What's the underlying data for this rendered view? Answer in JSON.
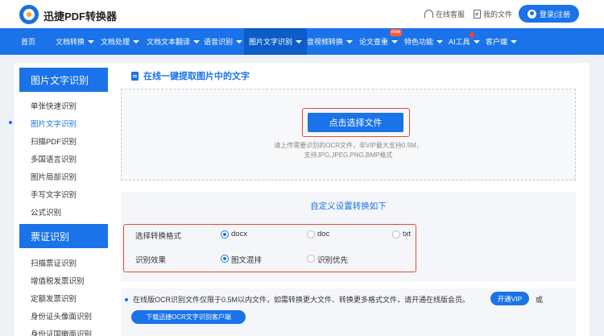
{
  "header": {
    "brand": "迅捷PDF转换器",
    "service_label": "在线客服",
    "my_files_label": "我的文件",
    "login_label": "登录|注册"
  },
  "nav": {
    "items": [
      {
        "label": "首页",
        "caret": false
      },
      {
        "label": "文档转换",
        "caret": true
      },
      {
        "label": "文档处理",
        "caret": true
      },
      {
        "label": "文档文本翻译",
        "caret": true
      },
      {
        "label": "语音识别",
        "caret": true
      },
      {
        "label": "图片文字识别",
        "caret": true,
        "active": true
      },
      {
        "label": "音视频转换",
        "caret": true
      },
      {
        "label": "论文查重",
        "caret": true
      },
      {
        "label": "特色功能",
        "caret": true
      },
      {
        "label": "AI工具",
        "caret": true
      },
      {
        "label": "客户端",
        "caret": true
      }
    ],
    "new_badge": "new"
  },
  "sidebar": {
    "section1_title": "图片文字识别",
    "section1_items": [
      "单张快速识别",
      "图片文字识别",
      "扫描PDF识别",
      "多国语言识别",
      "图片局部识别",
      "手写文字识别",
      "公式识别"
    ],
    "active_index": 1,
    "section2_title": "票证识别",
    "section2_items": [
      "扫描票证识别",
      "增值税发票识别",
      "定额发票识别",
      "身份证头像面识别",
      "身份证国徽面识别"
    ]
  },
  "main": {
    "title": "在线一键提取图片中的文字",
    "upload_button": "点击选择文件",
    "upload_hint_1": "请上传需要识别的OCR文件，非VIP最大支持0.5M，",
    "upload_hint_2": "支持JPG,JPEG,PNG,BMP格式",
    "settings_title": "自定义设置转换如下",
    "format_label": "选择转换格式",
    "format_options": [
      "docx",
      "doc",
      "txt"
    ],
    "format_selected": "docx",
    "effect_label": "识别效果",
    "effect_options": [
      "图文混排",
      "识别优先"
    ],
    "effect_selected": "图文混排",
    "notice_text": "在线版OCR识别文件仅限于0.5M以内文件，如需转换更大文件、转换更多格式文件，请开通在线版会员。",
    "vip_button": "开通VIP",
    "or_text": "或",
    "download_button": "下载迅捷OCR文字识别客户端"
  },
  "colors": {
    "primary": "#1a73e8",
    "highlight": "#e64a3b"
  }
}
